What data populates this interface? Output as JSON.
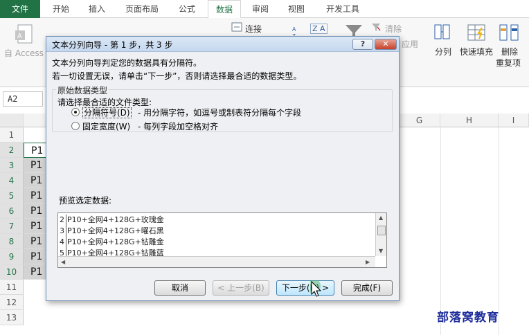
{
  "ribbon_tabs": [
    "文件",
    "开始",
    "插入",
    "页面布局",
    "公式",
    "数据",
    "审阅",
    "视图",
    "开发工具"
  ],
  "active_tab": "数据",
  "ribbon": {
    "access_label": "自 Access",
    "connect_label": "连接",
    "clear_label": "清除",
    "reapply_label": "应用",
    "split_label": "分列",
    "flash_fill_label": "快速填充",
    "remove_dup_label_1": "删除",
    "remove_dup_label_2": "重复项",
    "sort_asc_icon": "A↓Z",
    "sort_label": "Z A"
  },
  "name_box": "A2",
  "columns": {
    "g": "G",
    "h": "H",
    "i": "I"
  },
  "rows": [
    "1",
    "2",
    "3",
    "4",
    "5",
    "6",
    "7",
    "8",
    "9",
    "10",
    "11",
    "12",
    "13"
  ],
  "cell_texts": [
    "P1",
    "P1",
    "P1",
    "P1",
    "P1",
    "P1",
    "P1",
    "P1",
    "P1"
  ],
  "dialog": {
    "title": "文本分列向导 - 第 1 步，共 3 步",
    "help_label": "?",
    "close_label": "✕",
    "intro_line1": "文本分列向导判定您的数据具有分隔符。",
    "intro_line2": "若一切设置无误，请单击“下一步”，否则请选择最合适的数据类型。",
    "group_legend": "原始数据类型",
    "choose_label": "请选择最合适的文件类型:",
    "option1_label": "分隔符号(D)",
    "option1_desc": "- 用分隔字符，如逗号或制表符分隔每个字段",
    "option2_label": "固定宽度(W)",
    "option2_desc": "- 每列字段加空格对齐",
    "preview_label": "预览选定数据:",
    "preview_rows": [
      {
        "num": "2",
        "text": "P10+全网4+128G+玫瑰金"
      },
      {
        "num": "3",
        "text": "P10+全网4+128G+曜石黑"
      },
      {
        "num": "4",
        "text": "P10+全网4+128G+钻雕金"
      },
      {
        "num": "5",
        "text": "P10+全网4+128G+钻雕蓝"
      }
    ],
    "cancel_label": "取消",
    "back_label": "< 上一步(B)",
    "next_label": "下一步(N) >",
    "finish_label": "完成(F)"
  },
  "watermark": "部落窝教育",
  "colors": {
    "excel_green": "#217346",
    "watermark": "#1f2e9c"
  }
}
